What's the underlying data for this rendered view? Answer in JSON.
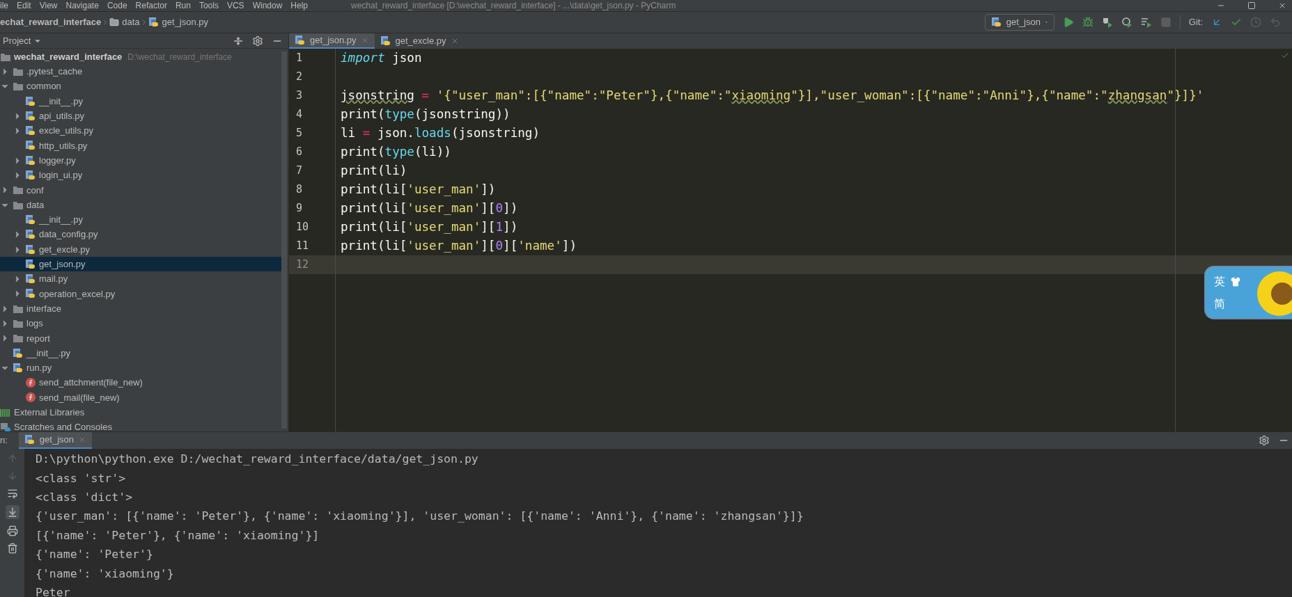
{
  "menu_bar": {
    "items": [
      "ile",
      "Edit",
      "View",
      "Navigate",
      "Code",
      "Refactor",
      "Run",
      "Tools",
      "VCS",
      "Window",
      "Help"
    ],
    "title": "wechat_reward_interface [D:\\wechat_reward_interface] - ...\\data\\get_json.py - PyCharm"
  },
  "breadcrumbs": [
    {
      "label": "echat_reward_interface",
      "kind": "project"
    },
    {
      "label": "data",
      "kind": "folder"
    },
    {
      "label": "get_json.py",
      "kind": "file"
    }
  ],
  "run_config": {
    "label": "get_json"
  },
  "vcs": {
    "label": "Git:"
  },
  "project_panel": {
    "title": "Project",
    "tree": [
      {
        "name": "wechat_reward_interface",
        "path": "D:\\wechat_reward_interface",
        "kind": "root",
        "selected": false,
        "children": [
          {
            "name": ".pytest_cache",
            "kind": "folder",
            "expanded": false,
            "selected": false
          },
          {
            "name": "common",
            "kind": "folder",
            "expanded": true,
            "selected": false,
            "children": [
              {
                "name": "__init__.py",
                "kind": "python",
                "selected": false
              },
              {
                "name": "api_utils.py",
                "kind": "python",
                "expanded": false,
                "selected": false
              },
              {
                "name": "excle_utils.py",
                "kind": "python",
                "expanded": false,
                "selected": false
              },
              {
                "name": "http_utils.py",
                "kind": "python",
                "selected": false
              },
              {
                "name": "logger.py",
                "kind": "python",
                "expanded": false,
                "selected": false
              },
              {
                "name": "login_ui.py",
                "kind": "python",
                "expanded": false,
                "selected": false
              }
            ]
          },
          {
            "name": "conf",
            "kind": "folder",
            "expanded": false,
            "selected": false
          },
          {
            "name": "data",
            "kind": "folder",
            "expanded": true,
            "selected": false,
            "children": [
              {
                "name": "__init__.py",
                "kind": "python",
                "selected": false
              },
              {
                "name": "data_config.py",
                "kind": "python",
                "expanded": false,
                "selected": false
              },
              {
                "name": "get_excle.py",
                "kind": "python",
                "expanded": false,
                "selected": false
              },
              {
                "name": "get_json.py",
                "kind": "python",
                "selected": true
              },
              {
                "name": "mail.py",
                "kind": "python",
                "expanded": false,
                "selected": false
              },
              {
                "name": "operation_excel.py",
                "kind": "python",
                "expanded": false,
                "selected": false
              }
            ]
          },
          {
            "name": "interface",
            "kind": "folder",
            "expanded": false,
            "selected": false
          },
          {
            "name": "logs",
            "kind": "folder",
            "expanded": false,
            "selected": false
          },
          {
            "name": "report",
            "kind": "folder",
            "expanded": false,
            "selected": false
          },
          {
            "name": "__init__.py",
            "kind": "python",
            "selected": false
          },
          {
            "name": "run.py",
            "kind": "python",
            "expanded": true,
            "selected": false,
            "children": [
              {
                "name": "send_attchment(file_new)",
                "kind": "function",
                "selected": false
              },
              {
                "name": "send_mail(file_new)",
                "kind": "function",
                "selected": false
              }
            ]
          }
        ]
      },
      {
        "name": "External Libraries",
        "kind": "libraries",
        "selected": false
      },
      {
        "name": "Scratches and Consoles",
        "kind": "scratches",
        "selected": false
      }
    ]
  },
  "editor_tabs": [
    {
      "label": "get_json.py",
      "selected": true
    },
    {
      "label": "get_excle.py",
      "selected": false
    }
  ],
  "editor": {
    "lines": [
      {
        "number": "1",
        "current": false,
        "tokens": [
          {
            "kind": "keyword",
            "text": "import"
          },
          {
            "kind": "plain",
            "text": " json"
          }
        ]
      },
      {
        "number": "2",
        "current": false
      },
      {
        "number": "3",
        "current": false,
        "tokens": [
          {
            "kind": "typo",
            "text": "jsonstring"
          },
          {
            "kind": "operator",
            "text": " = "
          },
          {
            "kind": "string",
            "text": "'{\"user_man\":[{\"name\":\"Peter\"},{\"name\":\""
          },
          {
            "kind": "string_typo",
            "text": "xiaoming"
          },
          {
            "kind": "string",
            "text": "\"}],\"user_woman\":[{\"name\":\"Anni\"},{\"name\":\""
          },
          {
            "kind": "string_typo",
            "text": "zhangsan"
          },
          {
            "kind": "string",
            "text": "\"}]}'"
          }
        ]
      },
      {
        "number": "4",
        "current": false,
        "tokens": [
          {
            "kind": "plain",
            "text": "print("
          },
          {
            "kind": "builtin",
            "text": "type"
          },
          {
            "kind": "plain",
            "text": "(jsonstring))"
          }
        ]
      },
      {
        "number": "5",
        "current": false,
        "tokens": [
          {
            "kind": "plain",
            "text": "li "
          },
          {
            "kind": "operator",
            "text": "="
          },
          {
            "kind": "plain",
            "text": " json."
          },
          {
            "kind": "builtin",
            "text": "loads"
          },
          {
            "kind": "plain",
            "text": "(jsonstring)"
          }
        ]
      },
      {
        "number": "6",
        "current": false,
        "tokens": [
          {
            "kind": "plain",
            "text": "print("
          },
          {
            "kind": "builtin",
            "text": "type"
          },
          {
            "kind": "plain",
            "text": "(li))"
          }
        ]
      },
      {
        "number": "7",
        "current": false,
        "tokens": [
          {
            "kind": "plain",
            "text": "print(li)"
          }
        ]
      },
      {
        "number": "8",
        "current": false,
        "tokens": [
          {
            "kind": "plain",
            "text": "print(li["
          },
          {
            "kind": "string",
            "text": "'user_man'"
          },
          {
            "kind": "plain",
            "text": "])"
          }
        ]
      },
      {
        "number": "9",
        "current": false,
        "tokens": [
          {
            "kind": "plain",
            "text": "print(li["
          },
          {
            "kind": "string",
            "text": "'user_man'"
          },
          {
            "kind": "plain",
            "text": "]["
          },
          {
            "kind": "number",
            "text": "0"
          },
          {
            "kind": "plain",
            "text": "])"
          }
        ]
      },
      {
        "number": "10",
        "current": false,
        "tokens": [
          {
            "kind": "plain",
            "text": "print(li["
          },
          {
            "kind": "string",
            "text": "'user_man'"
          },
          {
            "kind": "plain",
            "text": "]["
          },
          {
            "kind": "number",
            "text": "1"
          },
          {
            "kind": "plain",
            "text": "])"
          }
        ]
      },
      {
        "number": "11",
        "current": false,
        "tokens": [
          {
            "kind": "plain",
            "text": "print(li["
          },
          {
            "kind": "string",
            "text": "'user_man'"
          },
          {
            "kind": "plain",
            "text": "]["
          },
          {
            "kind": "number",
            "text": "0"
          },
          {
            "kind": "plain",
            "text": "]["
          },
          {
            "kind": "string",
            "text": "'name'"
          },
          {
            "kind": "plain",
            "text": "])"
          }
        ]
      },
      {
        "number": "12",
        "current": true
      }
    ]
  },
  "ime_toolbar": {
    "labels": [
      "英",
      "简"
    ]
  },
  "run_panel": {
    "label": "n:",
    "tabs": [
      {
        "label": "get_json",
        "selected": true
      }
    ],
    "output": [
      "D:\\python\\python.exe D:/wechat_reward_interface/data/get_json.py",
      "<class 'str'>",
      "<class 'dict'>",
      "{'user_man': [{'name': 'Peter'}, {'name': 'xiaoming'}], 'user_woman': [{'name': 'Anni'}, {'name': 'zhangsan'}]}",
      "[{'name': 'Peter'}, {'name': 'xiaoming'}]",
      "{'name': 'Peter'}",
      "{'name': 'xiaoming'}",
      "Peter"
    ]
  }
}
